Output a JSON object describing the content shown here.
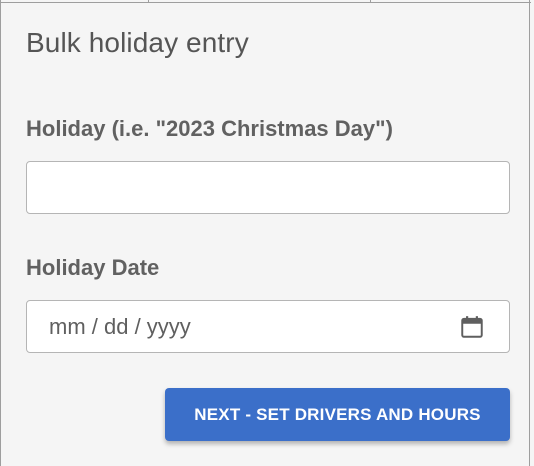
{
  "form": {
    "title": "Bulk holiday entry",
    "holiday_label": "Holiday (i.e. \"2023 Christmas Day\")",
    "holiday_value": "",
    "holiday_placeholder": "",
    "date_label": "Holiday Date",
    "date_placeholder": "mm / dd / yyyy",
    "date_icon": "calendar-icon",
    "next_button_label": "NEXT - SET DRIVERS AND HOURS"
  },
  "colors": {
    "background": "#f5f5f5",
    "primary_button": "#3b6fc9",
    "input_border": "#b5b5b5",
    "label_text": "#616161"
  }
}
